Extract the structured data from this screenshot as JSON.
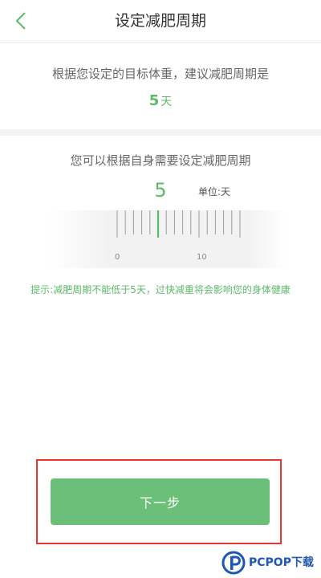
{
  "header": {
    "title": "设定减肥周期",
    "back_icon": "chevron-left-icon"
  },
  "summary": {
    "text": "根据您设定的目标体重，建议减肥周期是",
    "days": "5",
    "unit": "天"
  },
  "picker": {
    "prompt": "您可以根据自身需要设定减肥周期",
    "selected": "5",
    "unit_label": "单位:天",
    "tick_labels": [
      "0",
      "10"
    ],
    "selected_value": 5,
    "scale_min": 0,
    "scale_max": 15
  },
  "hint": "提示:减肥周期不能低于5天，过快减重将会影响您的身体健康",
  "next_button": "下一步",
  "watermark": {
    "text": "PCPOP下载"
  },
  "colors": {
    "accent": "#5cb96a",
    "button": "#6cbf78",
    "highlight_border": "#e53535",
    "watermark": "#1f57b7"
  }
}
